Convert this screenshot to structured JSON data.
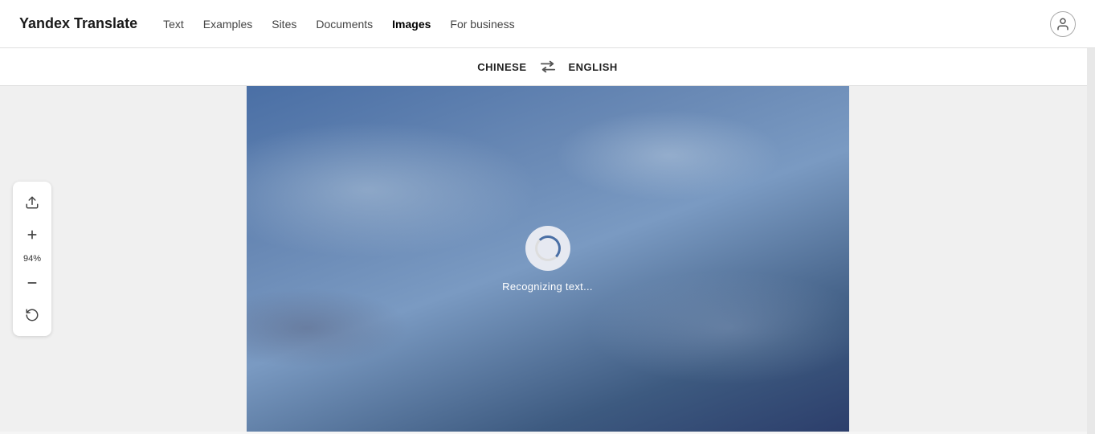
{
  "brand": {
    "name": "Yandex Translate"
  },
  "navbar": {
    "items": [
      {
        "label": "Text",
        "active": false
      },
      {
        "label": "Examples",
        "active": false
      },
      {
        "label": "Sites",
        "active": false
      },
      {
        "label": "Documents",
        "active": false
      },
      {
        "label": "Images",
        "active": true
      },
      {
        "label": "For business",
        "active": false
      }
    ]
  },
  "lang_bar": {
    "source_lang": "CHINESE",
    "target_lang": "ENGLISH",
    "swap_symbol": "⇄"
  },
  "tools": {
    "zoom_level": "94%",
    "zoom_in": "+",
    "zoom_out": "—"
  },
  "loading": {
    "text": "Recognizing text..."
  }
}
